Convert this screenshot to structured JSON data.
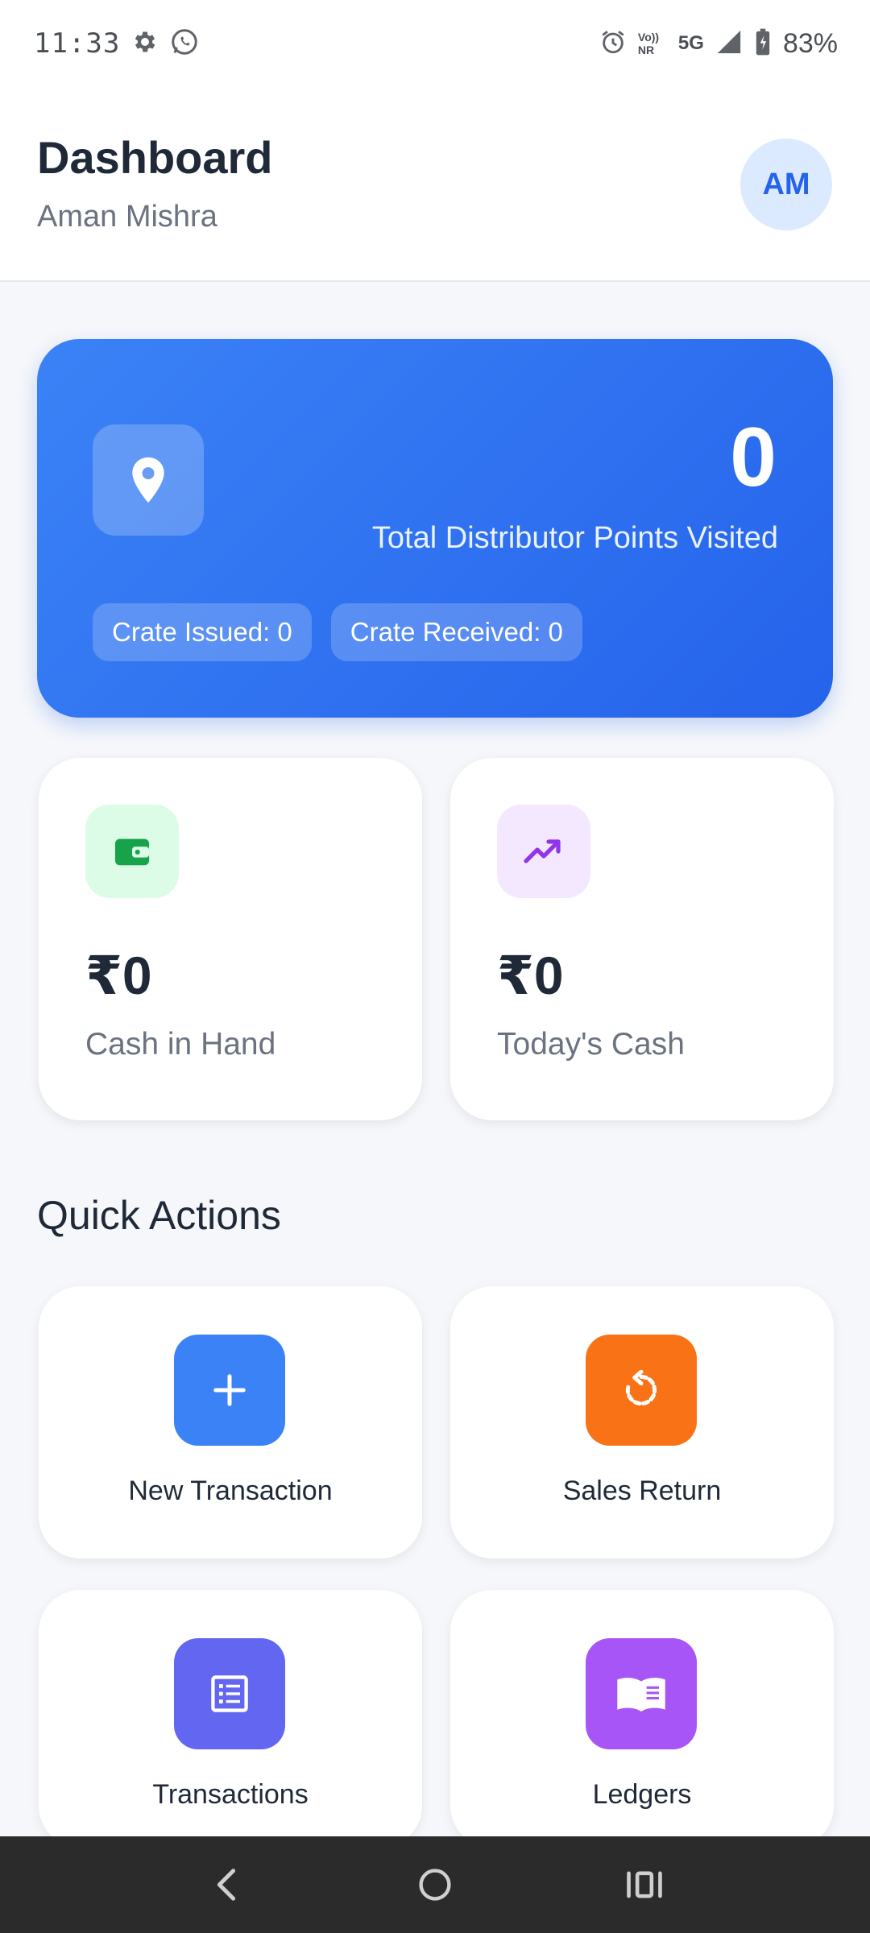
{
  "status_bar": {
    "time": "11:33",
    "battery": "83%",
    "network_label": "5G",
    "volte_label": "Vo)) NR"
  },
  "header": {
    "title": "Dashboard",
    "subtitle": "Aman Mishra",
    "avatar_initials": "AM"
  },
  "summary_card": {
    "value": "0",
    "label": "Total Distributor Points Visited",
    "chips": [
      "Crate Issued: 0",
      "Crate Received: 0"
    ],
    "icon": "location-pin-icon"
  },
  "stats": [
    {
      "value": "₹0",
      "label": "Cash in Hand",
      "icon": "wallet-icon",
      "icon_bg": "#dcfce7",
      "icon_color": "#16a34a"
    },
    {
      "value": "₹0",
      "label": "Today's Cash",
      "icon": "trending-up-icon",
      "icon_bg": "#f3e8ff",
      "icon_color": "#9333ea"
    }
  ],
  "quick_actions": {
    "title": "Quick Actions",
    "items": [
      {
        "label": "New Transaction",
        "icon": "plus-icon",
        "color": "#3b82f6"
      },
      {
        "label": "Sales Return",
        "icon": "return-icon",
        "color": "#f97316"
      },
      {
        "label": "Transactions",
        "icon": "list-icon",
        "color": "#6366f1"
      },
      {
        "label": "Ledgers",
        "icon": "book-icon",
        "color": "#a855f7"
      }
    ]
  },
  "colors": {
    "accent": "#2563eb",
    "background": "#f5f7fa"
  }
}
